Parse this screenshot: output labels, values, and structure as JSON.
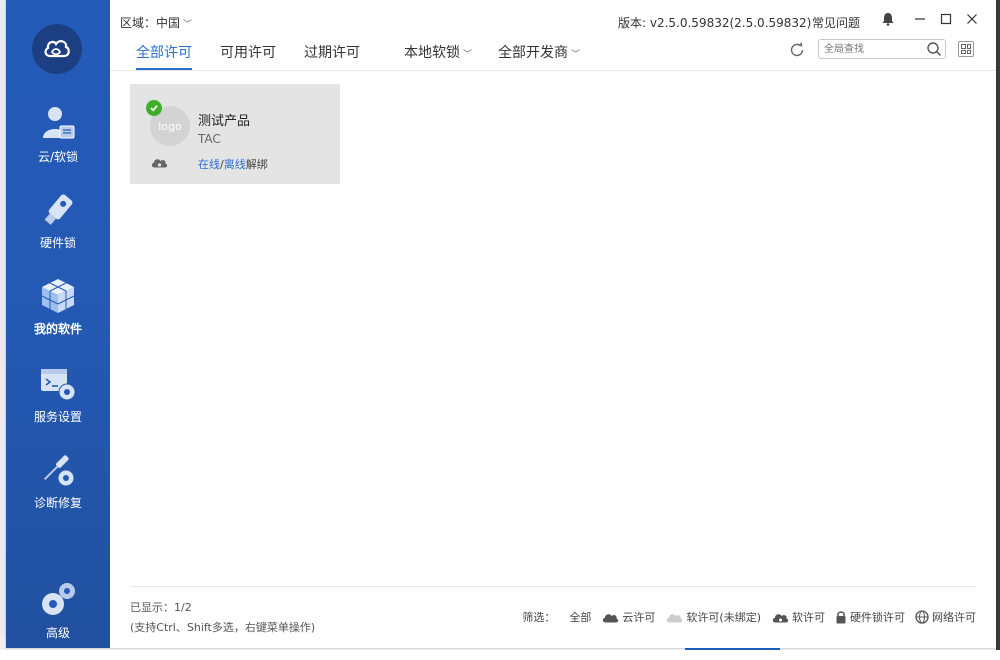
{
  "sidebar": {
    "items": [
      {
        "label": "云/软锁",
        "icon": "user-card-icon"
      },
      {
        "label": "硬件锁",
        "icon": "usb-key-icon"
      },
      {
        "label": "我的软件",
        "icon": "cube-icon"
      },
      {
        "label": "服务设置",
        "icon": "terminal-gear-icon"
      },
      {
        "label": "诊断修复",
        "icon": "screwdriver-gear-icon"
      },
      {
        "label": "高级",
        "icon": "gears-icon"
      }
    ],
    "active_index": 2
  },
  "topbar": {
    "region_label": "区域：",
    "region_value": "中国",
    "version": "版本: v2.5.0.59832(2.5.0.59832)",
    "faq": "常见问题"
  },
  "tabs": {
    "all": "全部许可",
    "available": "可用许可",
    "expired": "过期许可",
    "local_lock": "本地软锁",
    "all_developers": "全部开发商"
  },
  "search": {
    "placeholder": "全局查找"
  },
  "products": [
    {
      "logo_text": "logo",
      "name": "测试产品",
      "vendor": "TAC",
      "bind_online": "在线",
      "bind_sep": "/",
      "bind_offline": "离线",
      "bind_suffix": "解绑"
    }
  ],
  "footer": {
    "shown": "已显示：1/2",
    "hint": "(支持Ctrl、Shift多选，右键菜单操作)",
    "filter_label": "筛选：",
    "filters": [
      "全部",
      "云许可",
      "软许可(未绑定)",
      "软许可",
      "硬件锁许可",
      "网络许可"
    ]
  },
  "colors": {
    "sidebar": "#235bb8",
    "accent": "#2a6fd0",
    "active_check": "#3fae29",
    "card_bg": "#e4e4e4"
  }
}
